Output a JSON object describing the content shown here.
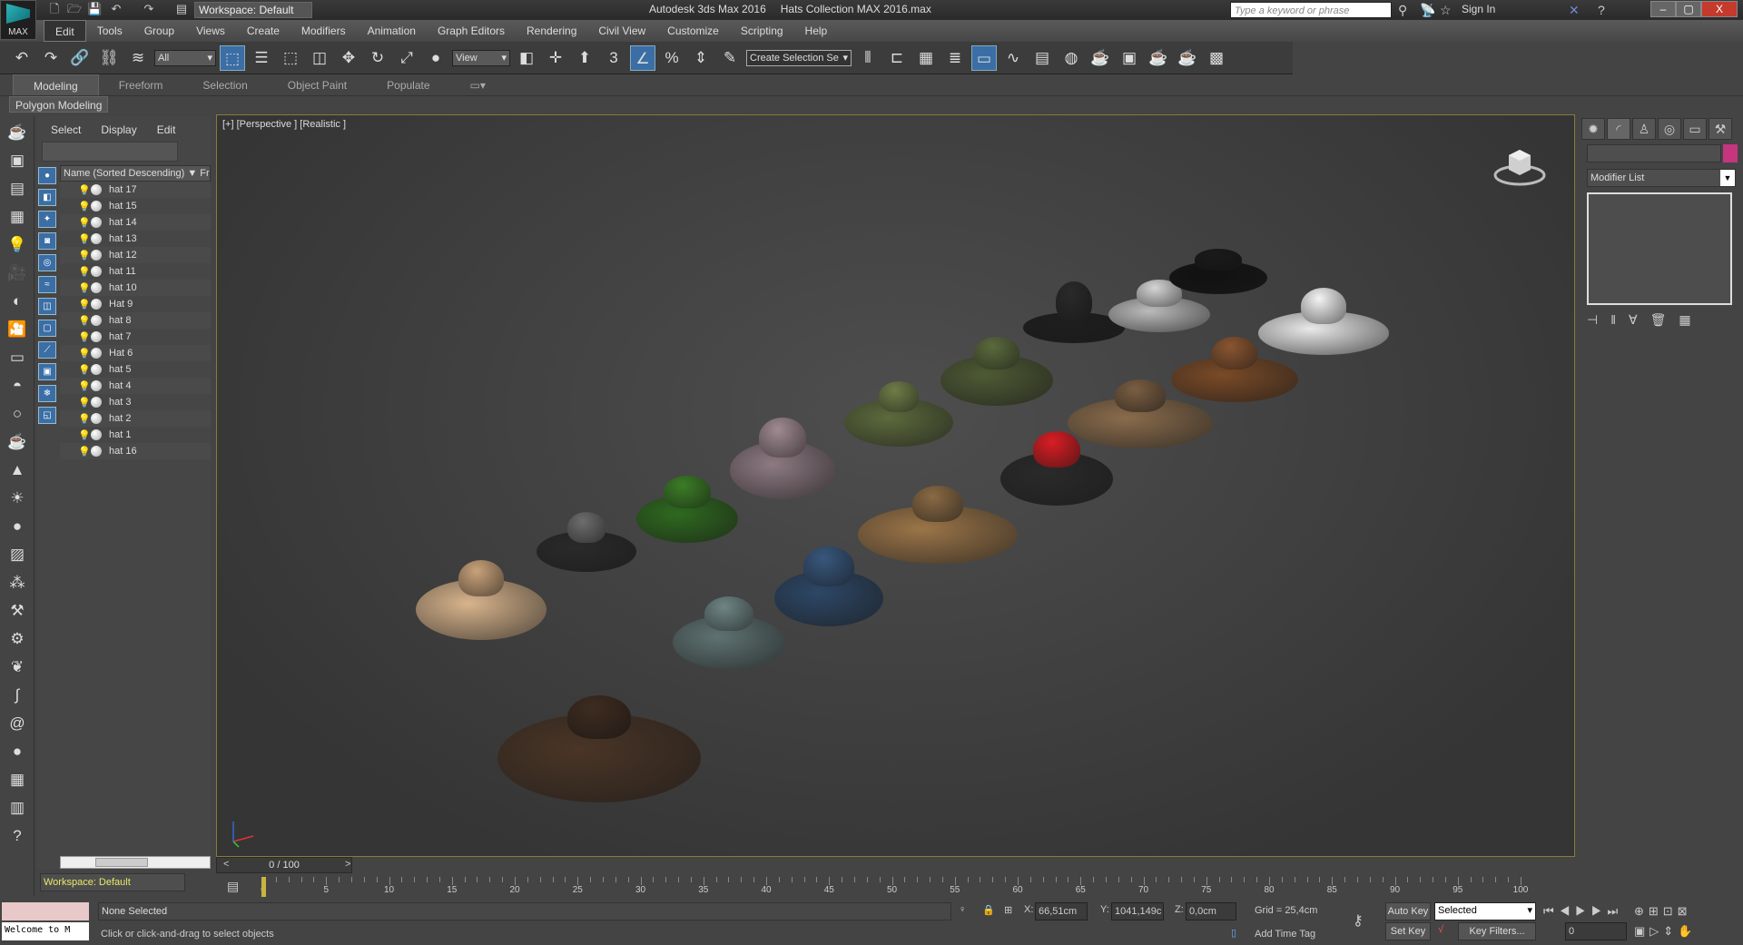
{
  "titlebar": {
    "logo_label": "MAX",
    "workspace": "Workspace: Default",
    "app_name": "Autodesk 3ds Max 2016",
    "file_name": "Hats Collection MAX 2016.max",
    "search_placeholder": "Type a keyword or phrase",
    "sign_in": "Sign In"
  },
  "menu": [
    "Edit",
    "Tools",
    "Group",
    "Views",
    "Create",
    "Modifiers",
    "Animation",
    "Graph Editors",
    "Rendering",
    "Civil View",
    "Customize",
    "Scripting",
    "Help"
  ],
  "toolbar": {
    "filter": "All",
    "ref_coord": "View",
    "selection_set": "Create Selection Se",
    "snap_label": "3"
  },
  "ribbon": {
    "tabs": [
      "Modeling",
      "Freeform",
      "Selection",
      "Object Paint",
      "Populate"
    ],
    "panel": "Polygon Modeling"
  },
  "explorer": {
    "menu": [
      "Select",
      "Display",
      "Edit"
    ],
    "column_header": "Name (Sorted Descending)",
    "column2": "Fr",
    "items": [
      "hat 17",
      "hat 15",
      "hat 14",
      "hat 13",
      "hat 12",
      "hat 11",
      "hat 10",
      "Hat 9",
      "hat 8",
      "hat 7",
      "Hat 6",
      "hat 5",
      "hat 4",
      "hat 3",
      "hat 2",
      "hat 1",
      "hat 16"
    ],
    "workspace": "Workspace: Default"
  },
  "viewport": {
    "label": "[+] [Perspective ] [Realistic ]",
    "hats": [
      {
        "name": "sheriff-hat",
        "brim": "#4a3526",
        "crown": "#3e2c20"
      },
      {
        "name": "straw-cowboy-hat",
        "brim": "#d8b48c",
        "crown": "#c9a27a"
      },
      {
        "name": "grey-fedora",
        "brim": "#2a2a2a",
        "crown": "#6d6d6d"
      },
      {
        "name": "green-beret",
        "brim": "#2e6a1e",
        "crown": "#3b7d26"
      },
      {
        "name": "plaid-cap",
        "brim": "#8d7a82",
        "crown": "#a08a92"
      },
      {
        "name": "grey-flat-cap",
        "brim": "#5f7272",
        "crown": "#6f8585"
      },
      {
        "name": "denim-beanie",
        "brim": "#2d4766",
        "crown": "#38577c"
      },
      {
        "name": "camo-bucket-hat",
        "brim": "#5c6a3c",
        "crown": "#6f7d48"
      },
      {
        "name": "tan-cowboy-hat",
        "brim": "#9b7548",
        "crown": "#8a6a44"
      },
      {
        "name": "camo-cap",
        "brim": "#4e5a34",
        "crown": "#5b6a3d"
      },
      {
        "name": "red-baseball-cap",
        "brim": "#2a2a2a",
        "crown": "#d81e24"
      },
      {
        "name": "top-hat",
        "brim": "#1e1e1e",
        "crown": "#2a2a2a"
      },
      {
        "name": "brown-cowboy-hat",
        "brim": "#8a6c4c",
        "crown": "#7a5e42"
      },
      {
        "name": "checkered-cap",
        "brim": "#bbbbbb",
        "crown": "#d5d5d5"
      },
      {
        "name": "police-cap",
        "brim": "#111111",
        "crown": "#1a1a1a"
      },
      {
        "name": "brown-fedora",
        "brim": "#7a4a26",
        "crown": "#8a5530"
      },
      {
        "name": "white-fedora",
        "brim": "#e9e9e9",
        "crown": "#f4f4f4"
      }
    ]
  },
  "command_panel": {
    "modifier_list": "Modifier List",
    "object_color": "#c5367f"
  },
  "timeline": {
    "slider": "0 / 100",
    "start": 0,
    "end": 100,
    "step": 5
  },
  "status": {
    "selection": "None Selected",
    "prompt": "Click or click-and-drag to select objects",
    "maxscript": "Welcome to M",
    "x_label": "X:",
    "x": "66,51cm",
    "y_label": "Y:",
    "y": "1041,149c",
    "z_label": "Z:",
    "z": "0,0cm",
    "grid": "Grid = 25,4cm",
    "add_time_tag": "Add Time Tag",
    "auto_key": "Auto Key",
    "set_key": "Set Key",
    "key_mode": "Selected",
    "key_filters": "Key Filters...",
    "frame": "0"
  }
}
